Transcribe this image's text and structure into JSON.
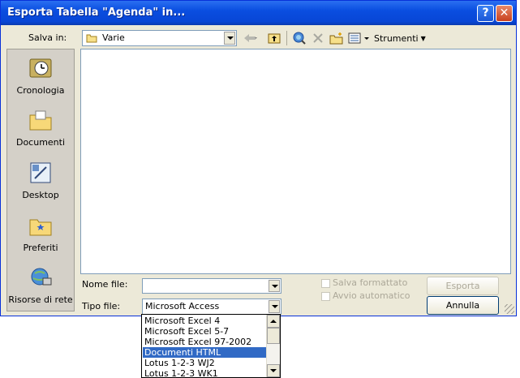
{
  "window": {
    "title": "Esporta Tabella \"Agenda\" in...",
    "help_glyph": "?",
    "close_glyph": "✕"
  },
  "toolbar": {
    "save_in_label": "Salva in:",
    "location": "Varie",
    "tools_label": "Strumenti"
  },
  "places": [
    {
      "label": "Cronologia",
      "icon": "history-icon"
    },
    {
      "label": "Documenti",
      "icon": "documents-folder-icon"
    },
    {
      "label": "Desktop",
      "icon": "desktop-icon"
    },
    {
      "label": "Preferiti",
      "icon": "favorites-folder-icon"
    },
    {
      "label": "Risorse di rete",
      "icon": "network-icon"
    }
  ],
  "form": {
    "filename_label": "Nome file:",
    "filename_value": "",
    "filetype_label": "Tipo file:",
    "filetype_value": "Microsoft Access",
    "save_formatted_label": "Salva formattato",
    "autostart_label": "Avvio automatico",
    "export_button": "Esporta",
    "cancel_button": "Annulla"
  },
  "filetype_options": [
    "Microsoft Excel 4",
    "Microsoft Excel 5-7",
    "Microsoft Excel 97-2002",
    "Documenti HTML",
    "Lotus 1-2-3 WJ2",
    "Lotus 1-2-3 WK1"
  ],
  "filetype_selected_index": 3,
  "colors": {
    "title_bar": "#0a4ee0",
    "selection": "#316ac5",
    "dialog_bg": "#ece9d8"
  }
}
